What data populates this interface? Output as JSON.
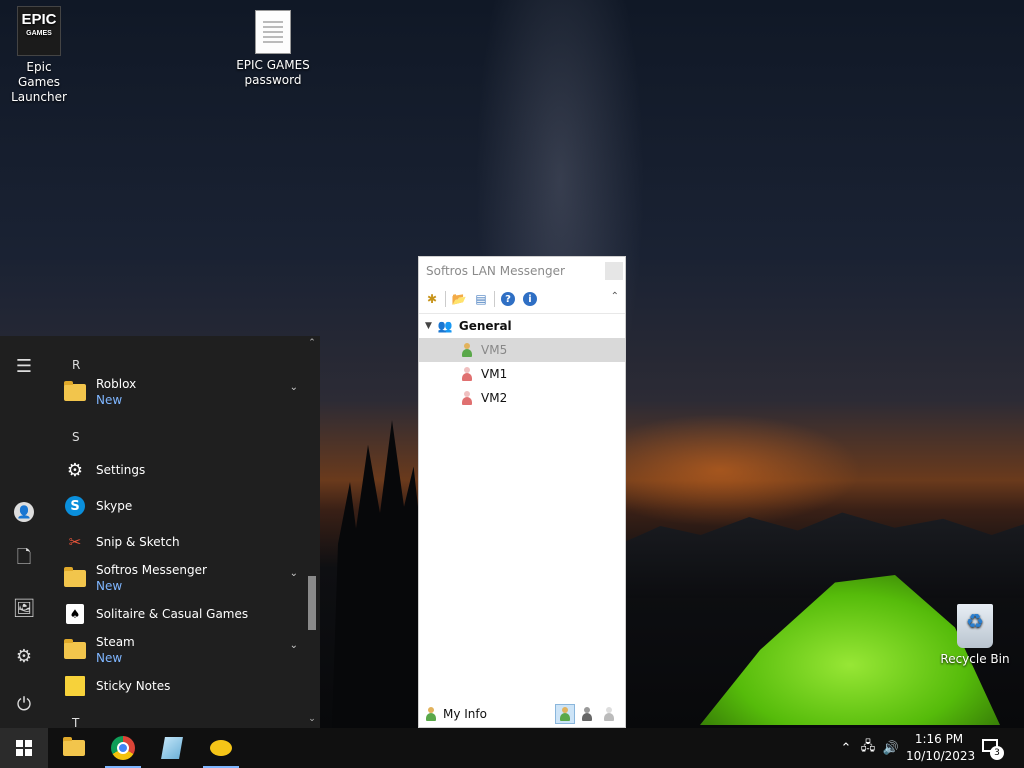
{
  "desktop": {
    "icons": [
      {
        "label": "Epic Games Launcher",
        "logo_text": "EPIC",
        "logo_sub": "GAMES"
      },
      {
        "label": "EPIC GAMES password"
      },
      {
        "label": "Recycle Bin"
      }
    ]
  },
  "start_menu": {
    "letters": [
      "R",
      "S",
      "T"
    ],
    "apps": [
      {
        "name": "Roblox",
        "sub": "New",
        "icon": "folder-icon",
        "expandable": true
      },
      {
        "name": "Settings",
        "icon": "gear-icon"
      },
      {
        "name": "Skype",
        "icon": "skype-icon"
      },
      {
        "name": "Snip & Sketch",
        "icon": "scissors-icon"
      },
      {
        "name": "Softros Messenger",
        "sub": "New",
        "icon": "folder-icon",
        "expandable": true
      },
      {
        "name": "Solitaire & Casual Games",
        "icon": "cards-icon"
      },
      {
        "name": "Steam",
        "sub": "New",
        "icon": "folder-icon",
        "expandable": true
      },
      {
        "name": "Sticky Notes",
        "icon": "sticky-note-icon"
      }
    ]
  },
  "messenger": {
    "title": "Softros LAN Messenger",
    "group": "General",
    "contacts": [
      {
        "name": "VM5",
        "selected": true,
        "status_color": "#6ab04c"
      },
      {
        "name": "VM1",
        "selected": false,
        "status_color": "#e07070"
      },
      {
        "name": "VM2",
        "selected": false,
        "status_color": "#e07070"
      }
    ],
    "my_info_label": "My Info"
  },
  "taskbar": {
    "time": "1:16 PM",
    "date": "10/10/2023",
    "notification_count": "3"
  },
  "colors": {
    "accent": "#7fb6ff",
    "start_bg": "#1f1f1f",
    "taskbar_bg": "#101010"
  }
}
